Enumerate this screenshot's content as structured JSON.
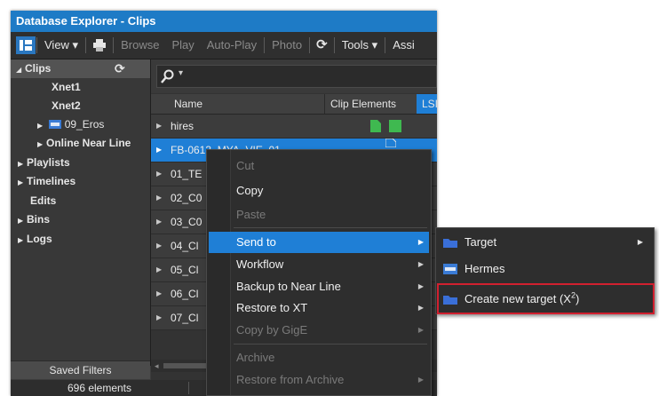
{
  "window": {
    "title": "Database Explorer - Clips",
    "title_bar_color": "#1e7bc6"
  },
  "toolbar": {
    "view": "View ▾",
    "browse": "Browse",
    "play": "Play",
    "autoplay": "Auto-Play",
    "photo": "Photo",
    "tools": "Tools ▾",
    "assist": "Assi"
  },
  "tree": {
    "clips": "Clips",
    "xnet1": "Xnet1",
    "xnet2": "Xnet2",
    "eros": "09_Eros",
    "online_near_line": "Online Near Line",
    "playlists": "Playlists",
    "timelines": "Timelines",
    "edits": "Edits",
    "bins": "Bins",
    "logs": "Logs"
  },
  "saved_filters": "Saved Filters",
  "status": {
    "elements": "696 elements"
  },
  "table": {
    "columns": {
      "name": "Name",
      "clip_elements": "Clip Elements",
      "lsi": "LSI"
    },
    "rows": [
      {
        "name": "hires"
      },
      {
        "name": "FB-0613_MYA_VIE_01"
      },
      {
        "name": "01_TE"
      },
      {
        "name": "02_C0"
      },
      {
        "name": "03_C0"
      },
      {
        "name": "04_Cl"
      },
      {
        "name": "05_Cl"
      },
      {
        "name": "06_Cl"
      },
      {
        "name": "07_Cl"
      }
    ]
  },
  "context_menu": {
    "cut": "Cut",
    "copy": "Copy",
    "paste": "Paste",
    "send_to": "Send to",
    "workflow": "Workflow",
    "backup": "Backup to Near Line",
    "restore_xt": "Restore to XT",
    "copy_gige": "Copy by GigE",
    "archive": "Archive",
    "restore_archive": "Restore from Archive"
  },
  "submenu": {
    "target": "Target",
    "hermes": "Hermes",
    "create_new_target": "Create new target (X",
    "create_new_target_sup": "2",
    "create_new_target_close": ")"
  },
  "colors": {
    "selection": "#1f7fd6",
    "highlight_box": "#d1202f",
    "clip_element_green": "#3fb950"
  }
}
